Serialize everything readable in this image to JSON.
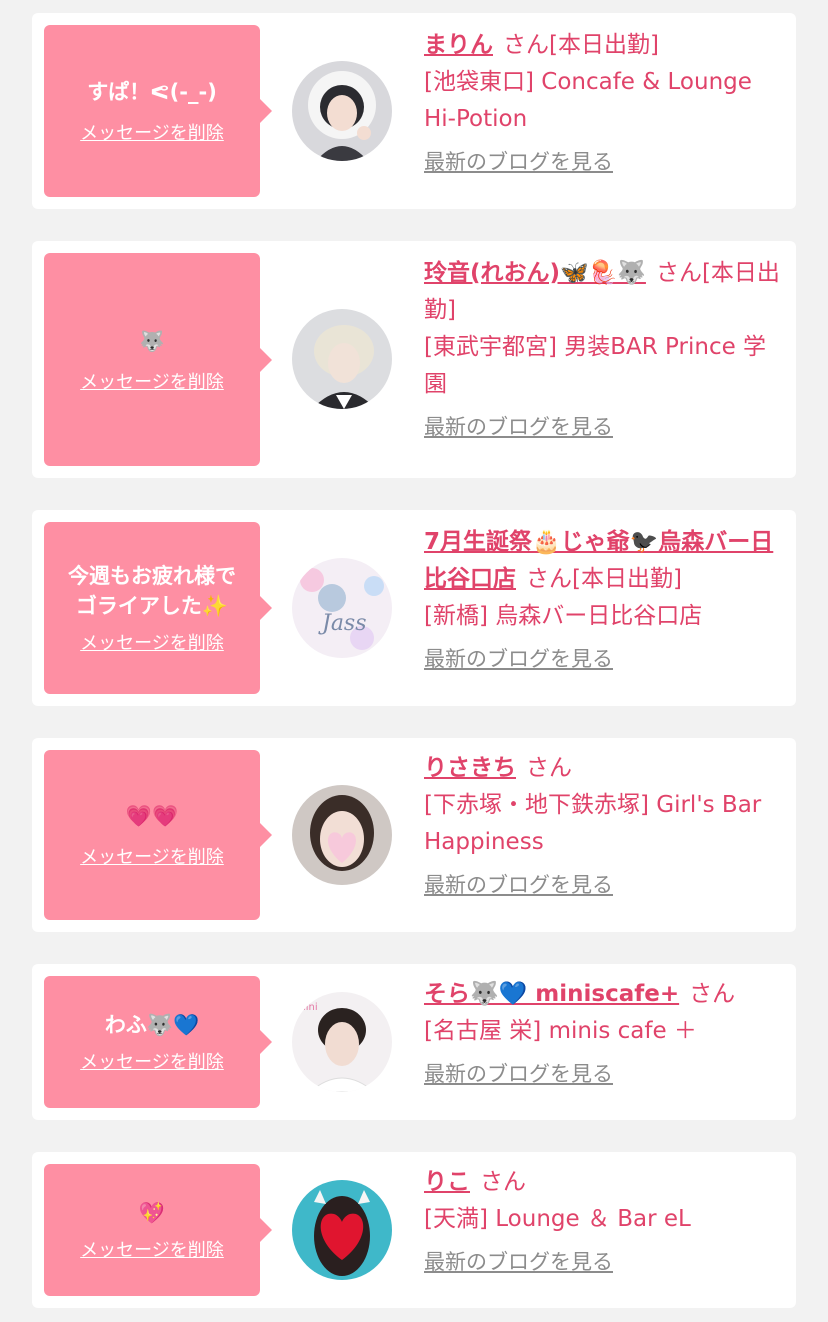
{
  "delete_label": "メッセージを削除",
  "san_label": "さん",
  "blog_label": "最新のブログを見る",
  "colors": {
    "accent": "#e0436a",
    "bubble": "#fe8fa3",
    "background": "#f2f2f2",
    "link_gray": "#8c8c8c"
  },
  "cards": [
    {
      "message": "すぱ！ᕙ(-_-)",
      "name": "まりん",
      "status": "[本日出勤]",
      "shop": "[池袋東口] Concafe & Lounge Hi-Potion"
    },
    {
      "message": "🐺",
      "name": "玲音(れおん)🦋🪼🐺",
      "status": "[本日出勤]",
      "shop": "[東武宇都宮] 男装BAR Prince 学園"
    },
    {
      "message": "今週もお疲れ様で\nゴライアした✨",
      "name": "7月生誕祭🎂じゃ爺🐦‍⬛烏森バー日比谷口店",
      "status": "[本日出勤]",
      "shop": "[新橋] 烏森バー日比谷口店"
    },
    {
      "message": "💗💗",
      "name": "りさきち",
      "status": "",
      "shop": "[下赤塚・地下鉄赤塚] Girl's Bar Happiness"
    },
    {
      "message": "わふ🐺💙",
      "name": "そら🐺💙 miniscafe+",
      "status": "",
      "shop": "[名古屋 栄] minis cafe ＋"
    },
    {
      "message": "💖",
      "name": "りこ",
      "status": "",
      "shop": "[天満] Lounge ＆ Bar eL"
    }
  ]
}
